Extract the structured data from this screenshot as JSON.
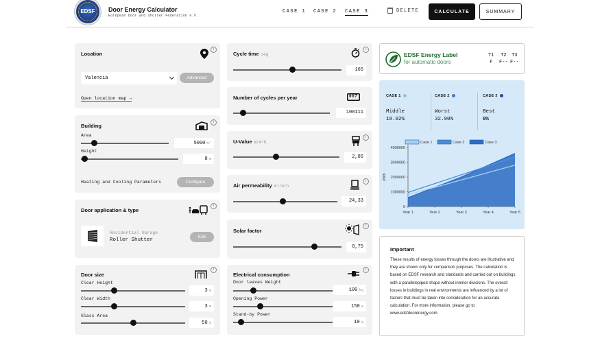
{
  "header": {
    "logo_text": "EDSF",
    "app_title": "Door Energy Calculator",
    "app_subtitle": "European Door and Shutter Federation e.V.",
    "cases": [
      {
        "label": "CASE 1",
        "active": false
      },
      {
        "label": "CASE 2",
        "active": false
      },
      {
        "label": "CASE 3",
        "active": true
      }
    ],
    "delete_label": "DELETE",
    "calculate_label": "CALCULATE",
    "summary_label": "SUMMARY"
  },
  "location": {
    "title": "Location",
    "selected": "Valencia",
    "advanced_label": "Advanced",
    "map_link": "Open location map →"
  },
  "building": {
    "title": "Building",
    "area_label": "Area",
    "area_value": "5000",
    "area_unit": "m²",
    "area_level": 0.15,
    "height_label": "Height",
    "height_value": "8",
    "height_unit": "m",
    "height_level": 0.04,
    "hc_label": "Heating and Cooling Parameters",
    "configure_label": "Configure"
  },
  "door_app": {
    "title": "Door application & type",
    "application": "Residential Garage",
    "type": "Roller Shutter",
    "edit_label": "Edit"
  },
  "door_size": {
    "title": "Door size",
    "clear_height_label": "Clear Height",
    "clear_height_value": "3",
    "clear_height_unit": "m",
    "clear_height_level": 0.32,
    "clear_width_label": "Clear Width",
    "clear_width_value": "3",
    "clear_width_unit": "m",
    "clear_width_level": 0.32,
    "glass_area_label": "Glass Area",
    "glass_area_value": "50",
    "glass_area_unit": "%",
    "glass_area_level": 0.5
  },
  "cycle_time": {
    "title": "Cycle time",
    "unit_label": "seg",
    "value": "165",
    "level": 0.55
  },
  "cycles_year": {
    "title": "Number of cycles per year",
    "value": "100111",
    "level": 0.1,
    "counter_text": "007"
  },
  "u_value": {
    "title": "U-Value",
    "unit_label": "W/m²K",
    "value": "2,85",
    "level": 0.4
  },
  "air_perm": {
    "title": "Air permeability",
    "unit_label": "m³/m²h",
    "value": "24,33",
    "level": 0.48
  },
  "solar": {
    "title": "Solar factor",
    "value": "0,75",
    "level": 0.75
  },
  "electrical": {
    "title": "Electrical consumption",
    "weight_label": "Door leaves Weight",
    "weight_value": "100",
    "weight_unit": "kg",
    "weight_level": 0.2,
    "opening_label": "Opening Power",
    "opening_value": "150",
    "opening_unit": "W",
    "opening_level": 0.27,
    "standby_label": "Stand-by Power",
    "standby_value": "10",
    "standby_unit": "W",
    "standby_level": 0.08
  },
  "energy_label": {
    "title": "EDSF Energy Label",
    "subtitle": "for automatic doors",
    "columns": [
      {
        "head": "T1",
        "val": "F"
      },
      {
        "head": "T2",
        "val": "F--"
      },
      {
        "head": "T3",
        "val": "F--"
      }
    ],
    "brand_color": "#1e6a2e"
  },
  "summary_cases": [
    {
      "head": "CASE 1",
      "name": "Middle",
      "pct": "18.02%",
      "color": "#8fc2ea"
    },
    {
      "head": "CASE 2",
      "name": "Worst",
      "pct": "32.90%",
      "color": "#3b7fc4"
    },
    {
      "head": "CASE 3",
      "name": "Best",
      "pct": "0%",
      "color": "#1d4f94"
    }
  ],
  "chart_data": {
    "type": "area",
    "x": [
      "Year 1",
      "Year 2",
      "Year 3",
      "Year 4",
      "Year 5"
    ],
    "ylabel": "kWh",
    "ylim": [
      0,
      4000000
    ],
    "yticks": [
      "0",
      "1000000",
      "2000000",
      "3000000",
      "4000000"
    ],
    "legend_position": "top",
    "series": [
      {
        "name": "Case 1",
        "values": [
          800000,
          1300000,
          1800000,
          2300000,
          2800000
        ],
        "color": "#a6d0f0"
      },
      {
        "name": "Case 2",
        "values": [
          950000,
          1550000,
          2150000,
          2750000,
          3350000
        ],
        "color": "#4a8fd6"
      },
      {
        "name": "Case 3",
        "values": [
          600000,
          1300000,
          2000000,
          2800000,
          3600000
        ],
        "color": "#2b6cc4"
      }
    ]
  },
  "important": {
    "title": "Important",
    "text": "These results of energy losses through the doors are illustrative and they are shown only for comparison purposes. The calculation is based on EDSF research and standards and carried out on buildings with a parallelepiped shape without interior divisions. The overall losses in buildings in real environments are influenced by a lot of factors that must be taken into consideration for an accurate calculation. For more information, please go to www.edsfdoorenergy.com."
  }
}
